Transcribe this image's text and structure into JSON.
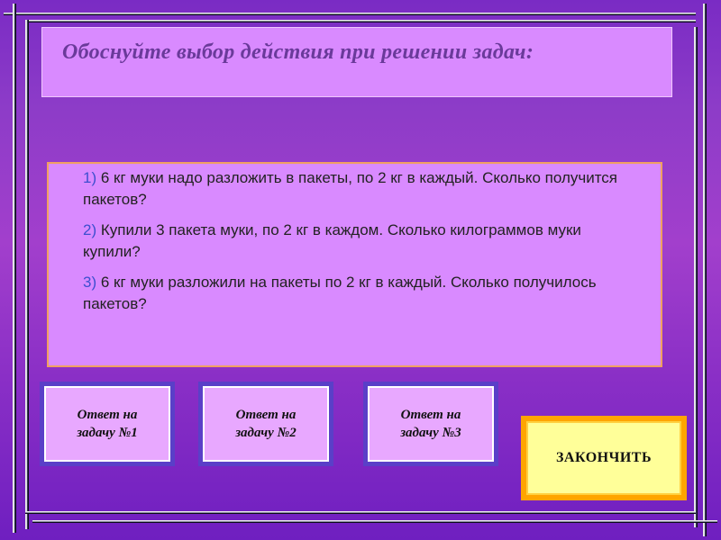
{
  "title": "Обоснуйте выбор действия при решении задач:",
  "tasks": [
    {
      "num": "1)",
      "text": "6 кг муки надо разложить в пакеты, по 2 кг в каждый. Сколько получится пакетов?"
    },
    {
      "num": "2)",
      "text": "Купили 3 пакета муки, по 2 кг в каждом. Сколько килограммов муки купили?"
    },
    {
      "num": "3)",
      "text": "6 кг муки разложили на пакеты по 2 кг в каждый. Сколько получилось пакетов?"
    }
  ],
  "buttons": {
    "answer1": {
      "line1": "Ответ на",
      "line2": "задачу №1"
    },
    "answer2": {
      "line1": "Ответ на",
      "line2": "задачу №2"
    },
    "answer3": {
      "line1": "Ответ на",
      "line2": "задачу №3"
    },
    "finish": "ЗАКОНЧИТЬ"
  },
  "colors": {
    "background": "#8d3cc8",
    "panel": "#d98aff",
    "task_number": "#3d4fcf",
    "answer_button_frame": "#5a3fc8",
    "finish_button": "#ffff99",
    "finish_border": "#ffa500"
  }
}
